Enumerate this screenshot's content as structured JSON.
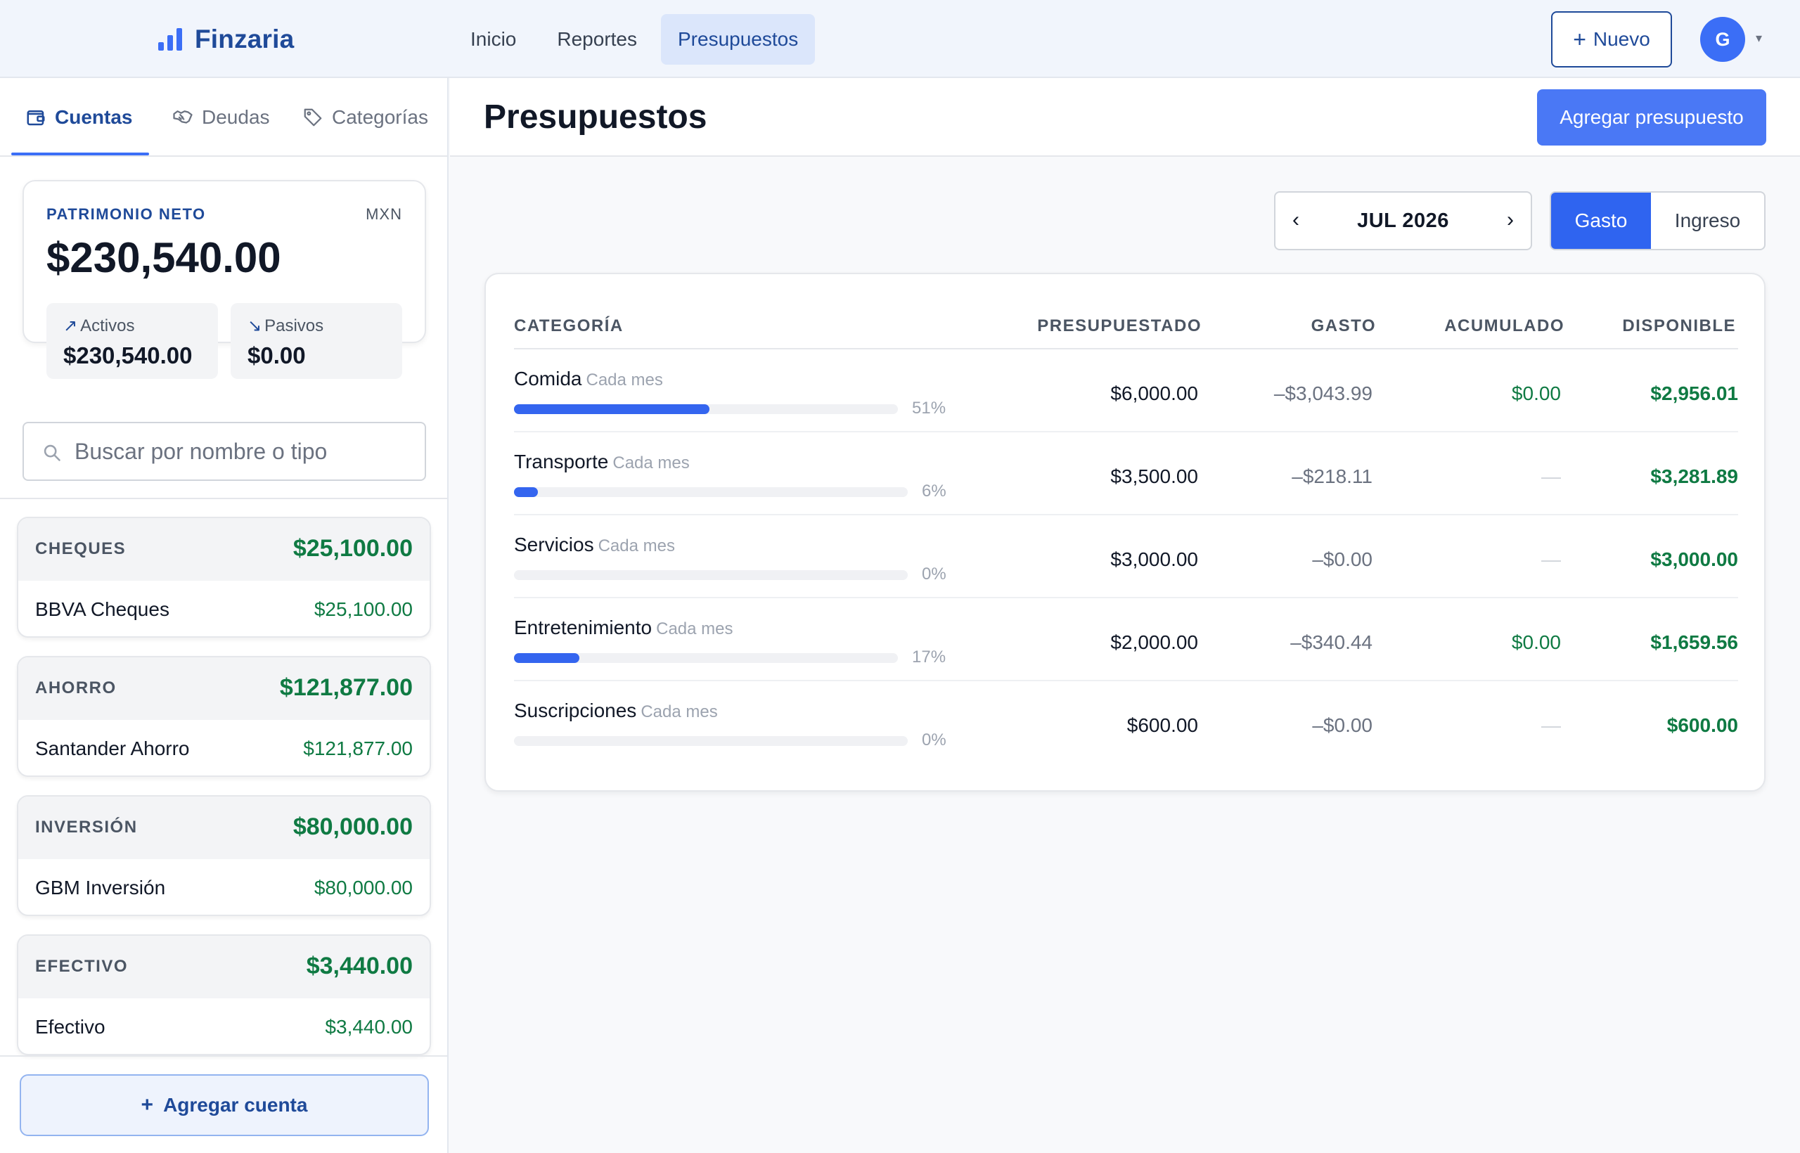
{
  "app": {
    "name": "Finzaria",
    "nav": [
      {
        "label": "Inicio",
        "active": false
      },
      {
        "label": "Reportes",
        "active": false
      },
      {
        "label": "Presupuestos",
        "active": true
      }
    ],
    "new_button": "Nuevo",
    "avatar_initial": "G"
  },
  "sidebar": {
    "tabs": [
      {
        "label": "Cuentas",
        "icon": "wallet-icon",
        "active": true
      },
      {
        "label": "Deudas",
        "icon": "handshake-icon",
        "active": false
      },
      {
        "label": "Categorías",
        "icon": "tag-icon",
        "active": false
      }
    ],
    "net_worth": {
      "label": "PATRIMONIO NETO",
      "currency": "MXN",
      "value": "$230,540.00",
      "assets_label": "Activos",
      "assets_value": "$230,540.00",
      "liabilities_label": "Pasivos",
      "liabilities_value": "$0.00"
    },
    "search_placeholder": "Buscar por nombre o tipo",
    "groups": [
      {
        "name": "CHEQUES",
        "total": "$25,100.00",
        "accounts": [
          {
            "name": "BBVA Cheques",
            "amount": "$25,100.00"
          }
        ]
      },
      {
        "name": "AHORRO",
        "total": "$121,877.00",
        "accounts": [
          {
            "name": "Santander Ahorro",
            "amount": "$121,877.00"
          }
        ]
      },
      {
        "name": "INVERSIÓN",
        "total": "$80,000.00",
        "accounts": [
          {
            "name": "GBM Inversión",
            "amount": "$80,000.00"
          }
        ]
      },
      {
        "name": "EFECTIVO",
        "total": "$3,440.00",
        "accounts": [
          {
            "name": "Efectivo",
            "amount": "$3,440.00"
          }
        ]
      }
    ],
    "add_account": "Agregar cuenta"
  },
  "main": {
    "title": "Presupuestos",
    "add_budget": "Agregar presupuesto",
    "month": {
      "prev": "‹",
      "label": "JUL 2026",
      "next": "›"
    },
    "type_toggle": [
      {
        "label": "Gasto",
        "active": true
      },
      {
        "label": "Ingreso",
        "active": false
      }
    ],
    "table": {
      "headers": {
        "category": "CATEGORÍA",
        "budgeted": "PRESUPUESTADO",
        "spent": "GASTO",
        "accumulated": "ACUMULADO",
        "available": "DISPONIBLE"
      },
      "rows": [
        {
          "category": "Comida",
          "frequency": "Cada mes",
          "progress": 0.51,
          "progress_label": "51%",
          "budgeted": "$6,000.00",
          "spent": "–$3,043.99",
          "accumulated": "$0.00",
          "available": "$2,956.01"
        },
        {
          "category": "Transporte",
          "frequency": "Cada mes",
          "progress": 0.06,
          "progress_label": "6%",
          "budgeted": "$3,500.00",
          "spent": "–$218.11",
          "accumulated": "—",
          "available": "$3,281.89"
        },
        {
          "category": "Servicios",
          "frequency": "Cada mes",
          "progress": 0.0,
          "progress_label": "0%",
          "budgeted": "$3,000.00",
          "spent": "–$0.00",
          "accumulated": "—",
          "available": "$3,000.00"
        },
        {
          "category": "Entretenimiento",
          "frequency": "Cada mes",
          "progress": 0.17,
          "progress_label": "17%",
          "budgeted": "$2,000.00",
          "spent": "–$340.44",
          "accumulated": "$0.00",
          "available": "$1,659.56"
        },
        {
          "category": "Suscripciones",
          "frequency": "Cada mes",
          "progress": 0.0,
          "progress_label": "0%",
          "budgeted": "$600.00",
          "spent": "–$0.00",
          "accumulated": "—",
          "available": "$600.00"
        }
      ]
    }
  }
}
